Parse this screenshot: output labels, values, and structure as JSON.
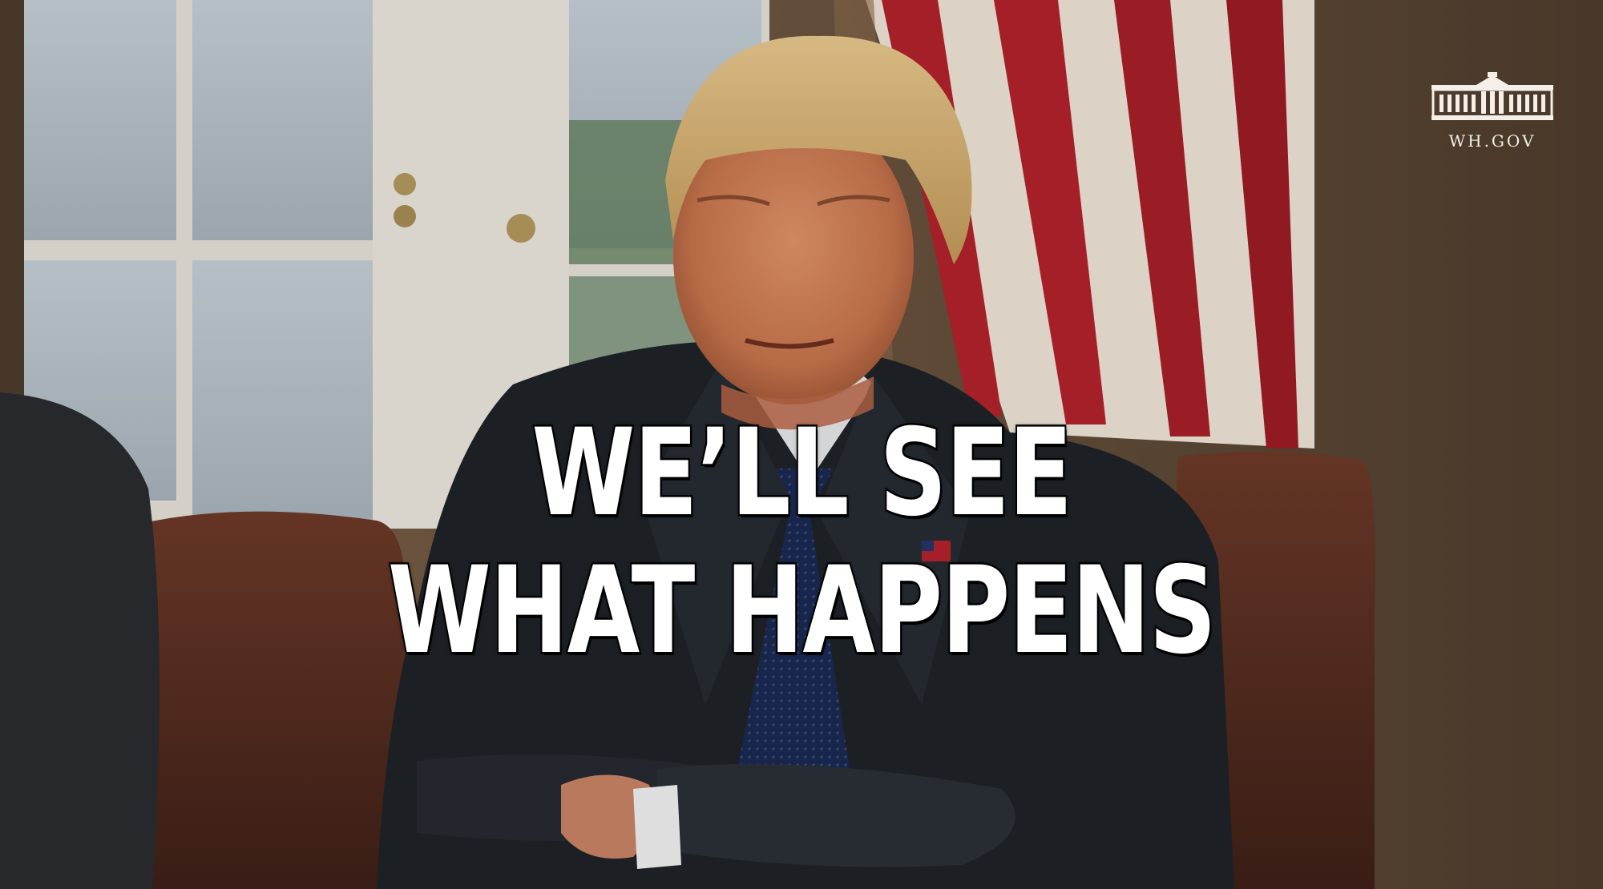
{
  "caption": {
    "line1": "WE’LL SEE",
    "line2": "WHAT HAPPENS"
  },
  "watermark": {
    "text": "WH.GOV",
    "icon": "white-house-icon"
  },
  "colors": {
    "caption_fill": "#ffffff",
    "caption_stroke": "#000000",
    "flag_red": "#b3222c",
    "flag_white": "#efe4d6",
    "suit": "#1f2329",
    "chair_leather": "#5a2f22",
    "wall": "#6b5540"
  }
}
